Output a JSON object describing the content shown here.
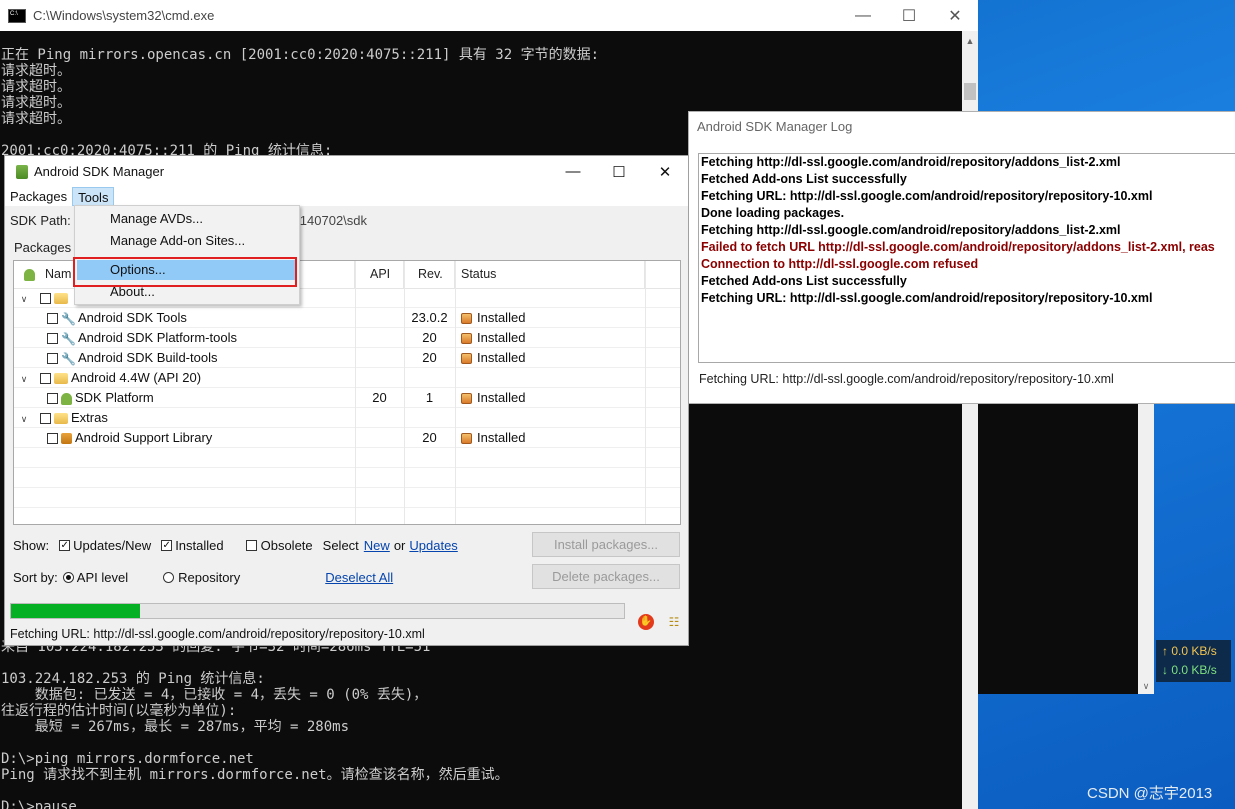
{
  "cmd": {
    "title": "C:\\Windows\\system32\\cmd.exe",
    "lines_top": [
      "正在 Ping mirrors.opencas.cn [2001:cc0:2020:4075::211] 具有 32 字节的数据:",
      "请求超时。",
      "请求超时。",
      "请求超时。",
      "请求超时。",
      "",
      "2001:cc0:2020:4075::211 的 Ping 统计信息:"
    ],
    "lines_bottom": [
      "来自 103.224.182.253 的回复: 字节=32 时间=286ms TTL=51",
      "",
      "103.224.182.253 的 Ping 统计信息:",
      "    数据包: 已发送 = 4，已接收 = 4，丢失 = 0 (0% 丢失)，",
      "往返行程的估计时间(以毫秒为单位):",
      "    最短 = 267ms，最长 = 287ms，平均 = 280ms",
      "",
      "D:\\>ping mirrors.dormforce.net",
      "Ping 请求找不到主机 mirrors.dormforce.net。请检查该名称，然后重试。",
      "",
      "D:\\>pause"
    ]
  },
  "netspeed": {
    "up": "↑ 0.0 KB/s",
    "down": "↓ 0.0 KB/s"
  },
  "log": {
    "title": "Android SDK Manager Log",
    "lines": [
      {
        "text": "Fetching http://dl-ssl.google.com/android/repository/addons_list-2.xml",
        "error": false
      },
      {
        "text": "Fetched Add-ons List successfully",
        "error": false
      },
      {
        "text": "Fetching URL: http://dl-ssl.google.com/android/repository/repository-10.xml",
        "error": false
      },
      {
        "text": "Done loading packages.",
        "error": false
      },
      {
        "text": "Fetching http://dl-ssl.google.com/android/repository/addons_list-2.xml",
        "error": false
      },
      {
        "text": "Failed to fetch URL http://dl-ssl.google.com/android/repository/addons_list-2.xml, reas",
        "error": true
      },
      {
        "text": "Connection to http://dl-ssl.google.com refused",
        "error": true
      },
      {
        "text": "Fetched Add-ons List successfully",
        "error": false
      },
      {
        "text": "Fetching URL: http://dl-ssl.google.com/android/repository/repository-10.xml",
        "error": false
      }
    ],
    "status": "Fetching URL: http://dl-ssl.google.com/android/repository/repository-10.xml"
  },
  "sdk": {
    "title": "Android SDK Manager",
    "menu": {
      "packages": "Packages",
      "tools": "Tools"
    },
    "sdk_path_label": "SDK Path:",
    "sdk_path_tail": "-20140702\\sdk",
    "packages_label": "Packages",
    "columns": {
      "name": "Nam",
      "api": "API",
      "rev": "Rev.",
      "status": "Status"
    },
    "rows": [
      {
        "level": 1,
        "checked": false,
        "icon": "wrench-blue",
        "name": "Android SDK Tools",
        "api": "",
        "rev": "23.0.2",
        "status": "Installed"
      },
      {
        "level": 1,
        "checked": false,
        "icon": "wrench-blue",
        "name": "Android SDK Platform-tools",
        "api": "",
        "rev": "20",
        "status": "Installed"
      },
      {
        "level": 1,
        "checked": false,
        "icon": "wrench-green",
        "name": "Android SDK Build-tools",
        "api": "",
        "rev": "20",
        "status": "Installed"
      },
      {
        "level": 0,
        "checked": false,
        "icon": "folder",
        "name": "Android 4.4W (API 20)",
        "api": "",
        "rev": "",
        "status": ""
      },
      {
        "level": 1,
        "checked": false,
        "icon": "android",
        "name": "SDK Platform",
        "api": "20",
        "rev": "1",
        "status": "Installed"
      },
      {
        "level": 0,
        "checked": false,
        "icon": "folder",
        "name": "Extras",
        "api": "",
        "rev": "",
        "status": ""
      },
      {
        "level": 1,
        "checked": false,
        "icon": "library",
        "name": "Android Support Library",
        "api": "",
        "rev": "20",
        "status": "Installed"
      }
    ],
    "show": {
      "label": "Show:",
      "updates_new": "Updates/New",
      "updates_new_checked": true,
      "installed": "Installed",
      "installed_checked": true,
      "obsolete": "Obsolete",
      "obsolete_checked": false,
      "select": "Select",
      "new_link": "New",
      "or": "or",
      "updates_link": "Updates"
    },
    "sort": {
      "label": "Sort by:",
      "api_level": "API level",
      "api_level_selected": true,
      "repository": "Repository",
      "deselect_all": "Deselect All"
    },
    "install_button": "Install packages...",
    "delete_button": "Delete packages...",
    "progress": 0.21,
    "status": "Fetching URL: http://dl-ssl.google.com/android/repository/repository-10.xml"
  },
  "tools_menu": {
    "items": [
      "Manage AVDs...",
      "Manage Add-on Sites...",
      "Options...",
      "About..."
    ],
    "highlighted": "Options..."
  },
  "watermark": "CSDN @志宇2013"
}
